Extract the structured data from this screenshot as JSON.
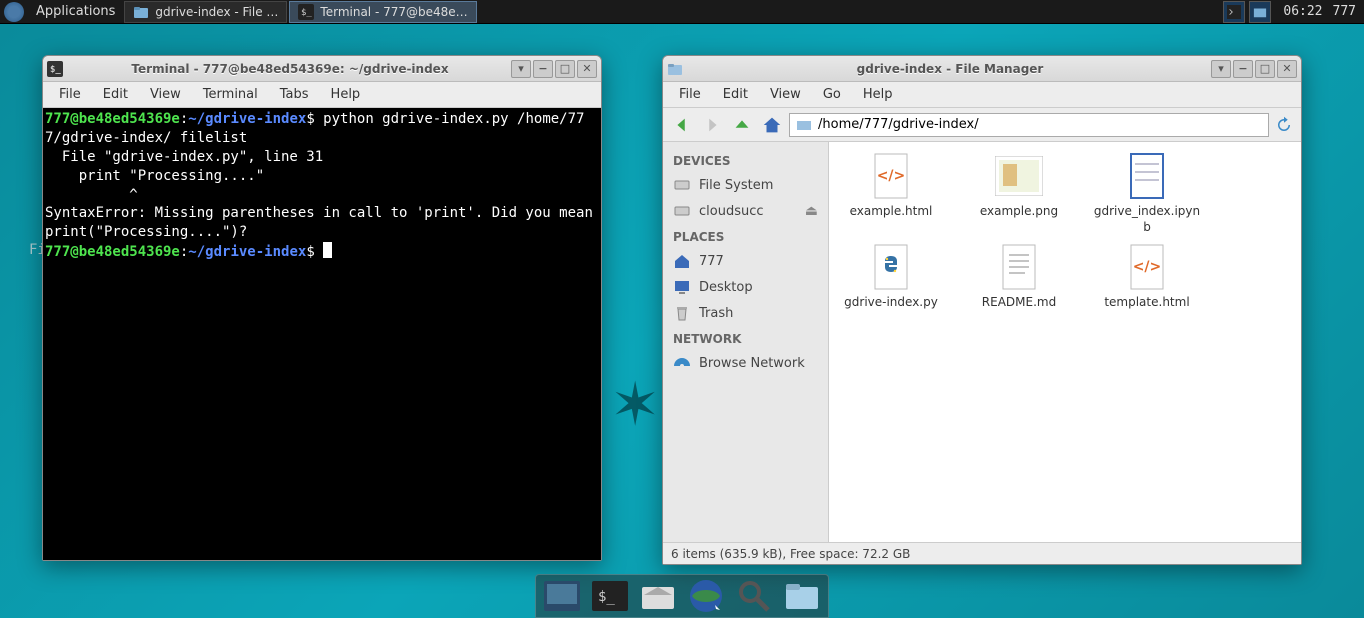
{
  "panel": {
    "applications_label": "Applications",
    "tasks": [
      {
        "label": "gdrive-index - File …",
        "active": false,
        "icon": "folder"
      },
      {
        "label": "Terminal - 777@be48e…",
        "active": true,
        "icon": "terminal"
      }
    ],
    "clock": "06:22",
    "user": "777"
  },
  "terminal": {
    "title": "Terminal - 777@be48ed54369e: ~/gdrive-index",
    "menus": [
      "File",
      "Edit",
      "View",
      "Terminal",
      "Tabs",
      "Help"
    ],
    "prompt_user": "777@be48ed54369e",
    "prompt_path": "~/gdrive-index",
    "command": "python gdrive-index.py /home/777/gdrive-index/ filelist",
    "err1": "  File \"gdrive-index.py\", line 31",
    "err2": "    print \"Processing....\"",
    "err3": "          ^",
    "err4": "SyntaxError: Missing parentheses in call to 'print'. Did you mean print(\"Processing....\")?"
  },
  "filemanager": {
    "title": "gdrive-index - File Manager",
    "menus": [
      "File",
      "Edit",
      "View",
      "Go",
      "Help"
    ],
    "path": "/home/777/gdrive-index/",
    "sidebar": {
      "devices_header": "DEVICES",
      "devices": [
        {
          "label": "File System",
          "icon": "drive"
        },
        {
          "label": "cloudsucc",
          "icon": "drive",
          "eject": true
        }
      ],
      "places_header": "PLACES",
      "places": [
        {
          "label": "777",
          "icon": "home"
        },
        {
          "label": "Desktop",
          "icon": "desktop"
        },
        {
          "label": "Trash",
          "icon": "trash"
        }
      ],
      "network_header": "NETWORK",
      "network": [
        {
          "label": "Browse Network",
          "icon": "network"
        }
      ]
    },
    "files": [
      {
        "name": "example.html",
        "type": "html"
      },
      {
        "name": "example.png",
        "type": "image"
      },
      {
        "name": "gdrive_index.ipynb",
        "type": "notebook"
      },
      {
        "name": "gdrive-index.py",
        "type": "python"
      },
      {
        "name": "README.md",
        "type": "text"
      },
      {
        "name": "template.html",
        "type": "html"
      }
    ],
    "status": "6 items (635.9 kB), Free space: 72.2 GB"
  },
  "dock": {
    "items": [
      "show-desktop",
      "terminal",
      "file-manager",
      "web-browser",
      "search",
      "folder"
    ]
  },
  "bg_fi": "Fi"
}
